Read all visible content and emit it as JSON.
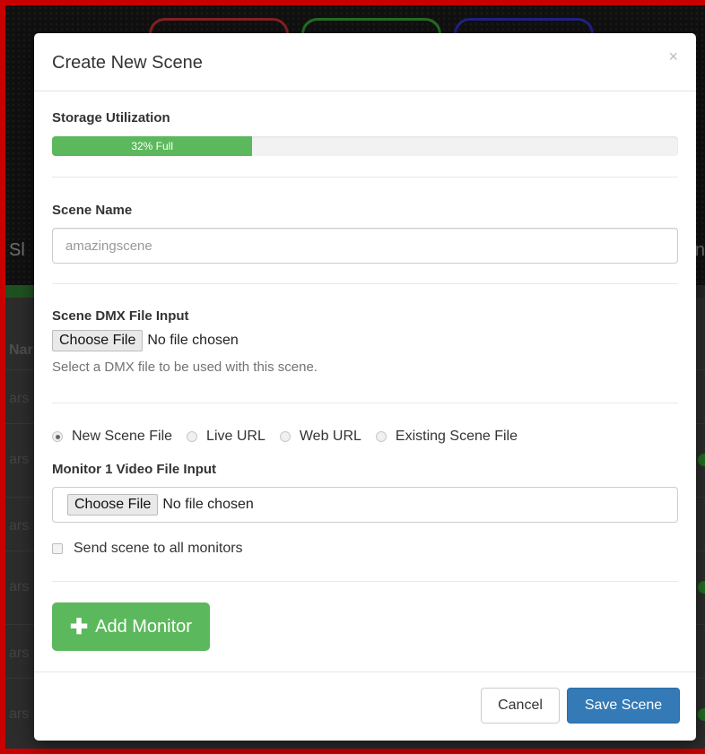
{
  "background": {
    "title_left": "Sl",
    "title_right": "n",
    "table_header": "Nar",
    "row_texts": [
      "ars",
      "ars",
      "ars",
      "ars",
      "ars",
      "ars"
    ]
  },
  "modal": {
    "title": "Create New Scene",
    "close_glyph": "×",
    "storage": {
      "label": "Storage Utilization",
      "percent": 32,
      "bar_text": "32% Full"
    },
    "scene_name": {
      "label": "Scene Name",
      "placeholder": "amazingscene"
    },
    "dmx": {
      "label": "Scene DMX File Input",
      "button": "Choose File",
      "status": "No file chosen",
      "help": "Select a DMX file to be used with this scene."
    },
    "source_options": [
      {
        "label": "New Scene File",
        "checked": true
      },
      {
        "label": "Live URL",
        "checked": false
      },
      {
        "label": "Web URL",
        "checked": false
      },
      {
        "label": "Existing Scene File",
        "checked": false
      }
    ],
    "monitor_video": {
      "label": "Monitor 1 Video File Input",
      "button": "Choose File",
      "status": "No file chosen"
    },
    "send_all": {
      "label": "Send scene to all monitors",
      "checked": false
    },
    "add_monitor": {
      "icon": "plus-icon",
      "label": "Add Monitor"
    },
    "footer": {
      "cancel": "Cancel",
      "save": "Save Scene"
    }
  },
  "colors": {
    "success": "#5cb85c",
    "primary": "#337ab7",
    "frame": "#c80000"
  }
}
